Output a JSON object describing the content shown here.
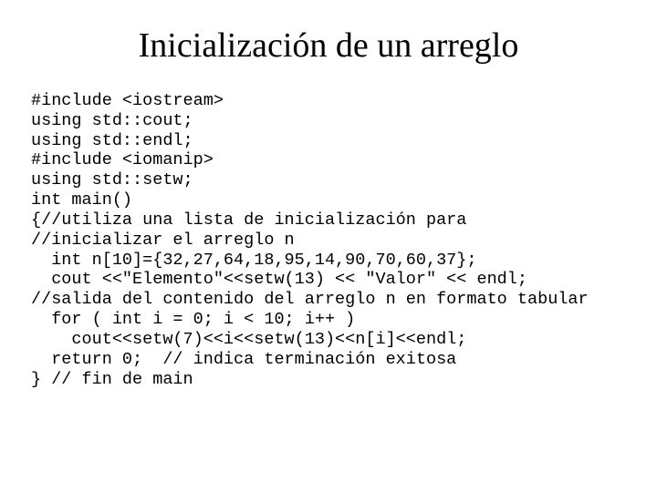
{
  "title": "Inicialización de un arreglo",
  "code_lines": [
    "#include <iostream>",
    "using std::cout;",
    "using std::endl;",
    "#include <iomanip>",
    "using std::setw;",
    "int main()",
    "{//utiliza una lista de inicialización para",
    "//inicializar el arreglo n",
    "  int n[10]={32,27,64,18,95,14,90,70,60,37};",
    "  cout <<\"Elemento\"<<setw(13) << \"Valor\" << endl;",
    "//salida del contenido del arreglo n en formato tabular",
    "  for ( int i = 0; i < 10; i++ )",
    "    cout<<setw(7)<<i<<setw(13)<<n[i]<<endl;",
    "  return 0;  // indica terminación exitosa",
    "} // fin de main"
  ]
}
